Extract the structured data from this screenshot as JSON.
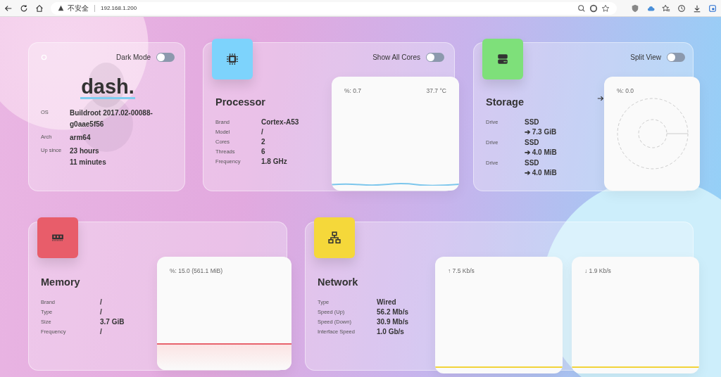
{
  "browser": {
    "security_label": "不安全",
    "url": "192.168.1.200"
  },
  "info": {
    "dark_mode_label": "Dark Mode",
    "dark_mode_on": false,
    "logo": "dash.",
    "rows": [
      {
        "label": "OS",
        "lines": [
          "Buildroot 2017.02-00088-",
          "g0aae5f56"
        ]
      },
      {
        "label": "Arch",
        "lines": [
          "arm64"
        ]
      },
      {
        "label": "Up since",
        "lines": [
          "23 hours",
          "11 minutes"
        ]
      }
    ]
  },
  "processor": {
    "title": "Processor",
    "toggle_label": "Show All Cores",
    "toggle_on": false,
    "rows": [
      {
        "label": "Brand",
        "value": "Cortex-A53"
      },
      {
        "label": "Model",
        "value": "/"
      },
      {
        "label": "Cores",
        "value": "2"
      },
      {
        "label": "Threads",
        "value": "6"
      },
      {
        "label": "Frequency",
        "value": "1.8 GHz"
      }
    ],
    "chart": {
      "usage": "%: 0.7",
      "temperature": "37.7 °C"
    }
  },
  "storage": {
    "title": "Storage",
    "toggle_label": "Split View",
    "toggle_on": false,
    "drives": [
      {
        "label": "Drive",
        "type": "SSD",
        "size": "➔ 7.3 GiB"
      },
      {
        "label": "Drive",
        "type": "SSD",
        "size": "➔ 4.0 MiB"
      },
      {
        "label": "Drive",
        "type": "SSD",
        "size": "➔ 4.0 MiB"
      }
    ],
    "chart": {
      "usage": "%: 0.0"
    }
  },
  "memory": {
    "title": "Memory",
    "rows": [
      {
        "label": "Brand",
        "value": "/"
      },
      {
        "label": "Type",
        "value": "/"
      },
      {
        "label": "Size",
        "value": "3.7 GiB"
      },
      {
        "label": "Frequency",
        "value": "/"
      }
    ],
    "chart": {
      "usage": "%: 15.0 (561.1 MiB)"
    }
  },
  "network": {
    "title": "Network",
    "rows": [
      {
        "label": "Type",
        "value": "Wired"
      },
      {
        "label": "Speed (Up)",
        "value": "56.2 Mb/s"
      },
      {
        "label": "Speed (Down)",
        "value": "30.9 Mb/s"
      },
      {
        "label": "Interface Speed",
        "value": "1.0 Gb/s"
      }
    ],
    "charts": [
      {
        "reading": "↑ 7.5 Kb/s"
      },
      {
        "reading": "↓ 1.9 Kb/s"
      }
    ]
  }
}
